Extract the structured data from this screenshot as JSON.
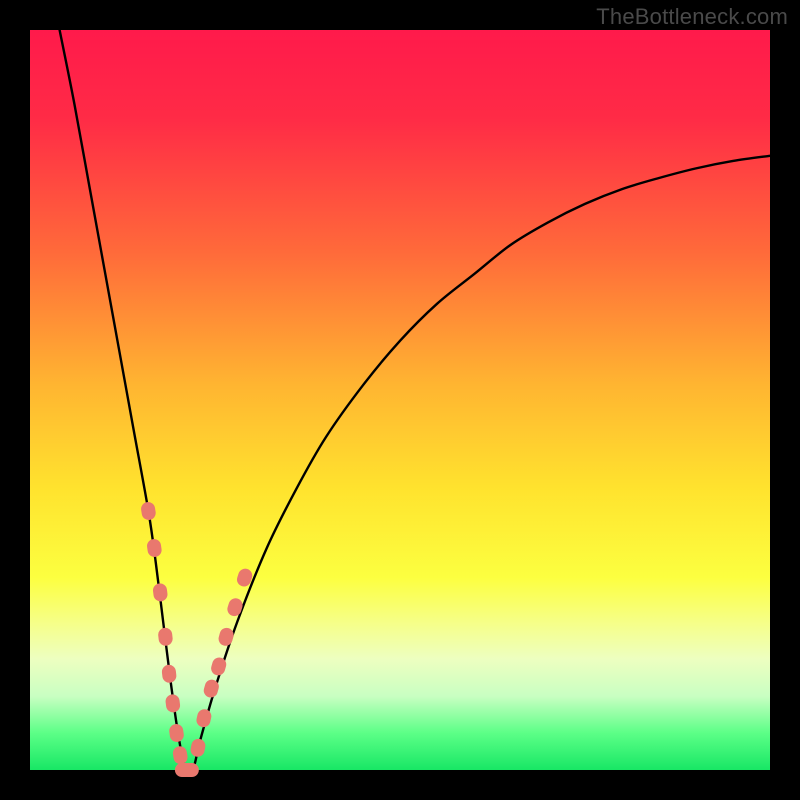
{
  "watermark": "TheBottleneck.com",
  "gradient": {
    "stops": [
      {
        "pct": 0,
        "color": "#ff1a4b"
      },
      {
        "pct": 12,
        "color": "#ff2b46"
      },
      {
        "pct": 30,
        "color": "#ff6a3a"
      },
      {
        "pct": 48,
        "color": "#ffb531"
      },
      {
        "pct": 62,
        "color": "#ffe32e"
      },
      {
        "pct": 74,
        "color": "#fcff40"
      },
      {
        "pct": 80,
        "color": "#f6ff87"
      },
      {
        "pct": 85,
        "color": "#edffc0"
      },
      {
        "pct": 90,
        "color": "#c9ffc2"
      },
      {
        "pct": 95,
        "color": "#5cff87"
      },
      {
        "pct": 100,
        "color": "#18e765"
      }
    ]
  },
  "chart_data": {
    "type": "line",
    "title": "",
    "xlabel": "",
    "ylabel": "",
    "xlim": [
      0,
      100
    ],
    "ylim": [
      0,
      100
    ],
    "grid": false,
    "series": [
      {
        "name": "curve",
        "stroke": "#000000",
        "stroke_width": 2.4,
        "x": [
          4,
          6,
          8,
          10,
          12,
          14,
          16,
          17,
          18,
          19,
          20,
          21,
          22,
          23,
          25,
          28,
          32,
          36,
          40,
          45,
          50,
          55,
          60,
          65,
          70,
          75,
          80,
          85,
          90,
          95,
          100
        ],
        "y": [
          100,
          90,
          79,
          68,
          57,
          46,
          35,
          28,
          20,
          12,
          5,
          0,
          0,
          4,
          11,
          20,
          30,
          38,
          45,
          52,
          58,
          63,
          67,
          71,
          74,
          76.5,
          78.5,
          80,
          81.3,
          82.3,
          83
        ]
      },
      {
        "name": "highlight-dots-left",
        "stroke": "#e9786e",
        "dot_radius": 7,
        "shape": "rounded-dash",
        "x": [
          16.0,
          16.8,
          17.6,
          18.3,
          18.8,
          19.3,
          19.8,
          20.3
        ],
        "y": [
          35,
          30,
          24,
          18,
          13,
          9,
          5,
          2
        ]
      },
      {
        "name": "highlight-dots-right",
        "stroke": "#e9786e",
        "dot_radius": 7,
        "shape": "rounded-dash",
        "x": [
          22.7,
          23.5,
          24.5,
          25.5,
          26.5,
          27.7,
          29.0
        ],
        "y": [
          3,
          7,
          11,
          14,
          18,
          22,
          26
        ]
      },
      {
        "name": "highlight-dots-bottom",
        "stroke": "#e9786e",
        "dot_radius": 7,
        "shape": "rounded-dash",
        "x": [
          20.8,
          21.6
        ],
        "y": [
          0,
          0
        ]
      }
    ]
  }
}
